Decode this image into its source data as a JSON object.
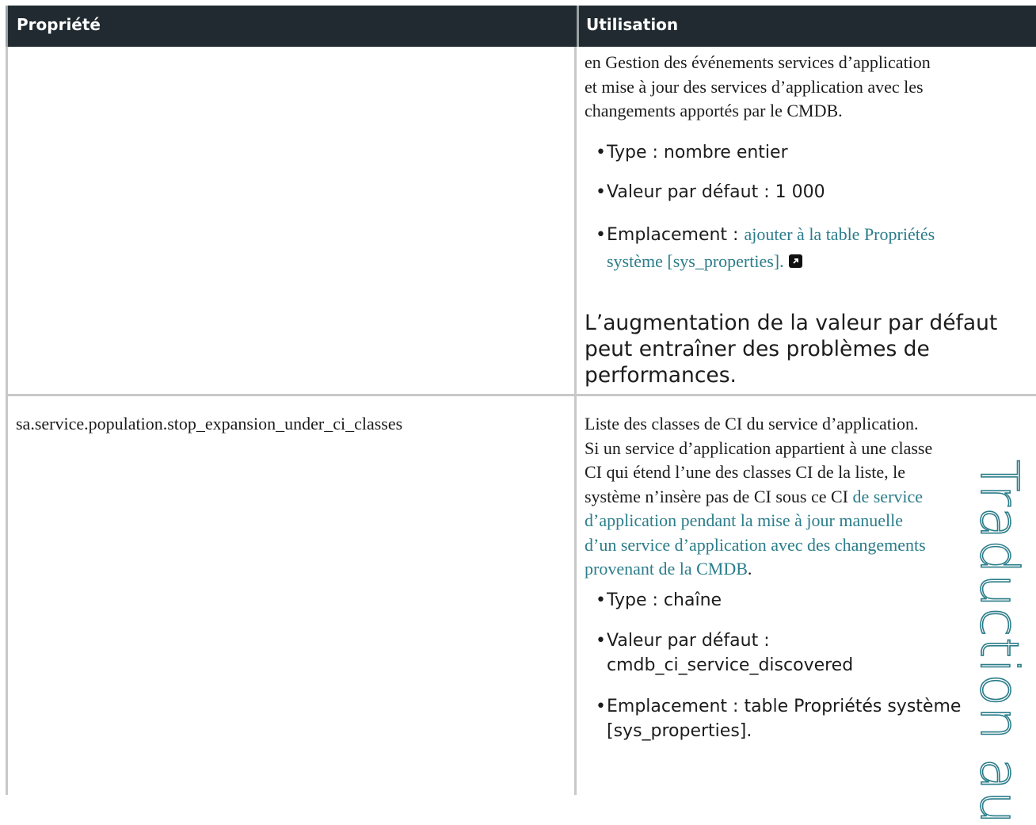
{
  "table": {
    "headers": {
      "property": "Propriété",
      "usage": "Utilisation"
    },
    "row1": {
      "usage_lines": [
        "en Gestion des événements services d’application",
        "et mise à jour des services d’application avec les",
        "changements apportés par le CMDB."
      ],
      "bullets": {
        "type": "Type : nombre entier",
        "default": "Valeur par défaut : 1 000",
        "location_prefix": "Emplacement : ",
        "location_link_line1": "ajouter à la table Propriétés",
        "location_link_line2": "système [sys_properties]."
      },
      "note_lines": [
        "L’augmentation de la valeur par défaut",
        "peut entraîner des problèmes de",
        "performances."
      ]
    },
    "row2": {
      "property": "sa.service.population.stop_expansion_under_ci_classes",
      "usage_lines": {
        "l1": "Liste des classes de CI du service d’application.",
        "l2": "Si un service d’application appartient à une classe",
        "l3": "CI qui étend l’une des classes CI de la liste, le",
        "l4_plain": "système n’insère pas de CI sous ce CI ",
        "l4_link": "de service",
        "l5": "d’application pendant la mise à jour manuelle",
        "l6": "d’un service d’application avec des changements",
        "l7_link": "provenant de la CMDB",
        "l7_tail": "."
      },
      "bullets": {
        "type": "Type : chaîne",
        "default_line1": "Valeur par défaut :",
        "default_line2": "cmdb_ci_service_discovered",
        "location_line1": "Emplacement : table Propriétés système",
        "location_line2": "[sys_properties]."
      }
    }
  },
  "watermark": "Traduction au",
  "colors": {
    "header_bg": "#202a30",
    "link": "#2b7d8a",
    "grid": "#c8c8c8"
  },
  "icons": {
    "external_link": "external-link-icon",
    "bullet": "bullet-dot"
  }
}
